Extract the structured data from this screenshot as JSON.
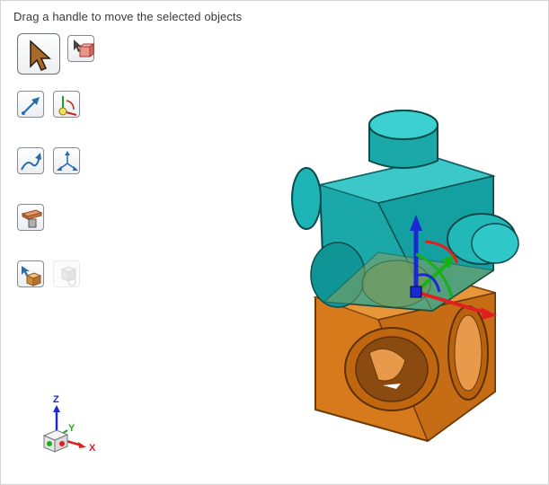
{
  "status": {
    "text": "Drag a handle to move the selected objects"
  },
  "toolbar": {
    "items": [
      {
        "name": "select-pointer-button",
        "icon": "arrow-pointer-icon",
        "active": true
      },
      {
        "name": "select-box-button",
        "icon": "pointer-box-icon"
      },
      {
        "name": "move-along-vector-button",
        "icon": "arrow-vector-icon"
      },
      {
        "name": "rotate-about-axis-button",
        "icon": "axis-rotate-icon"
      },
      {
        "name": "move-along-curve-button",
        "icon": "curve-arrow-icon"
      },
      {
        "name": "free-move-button",
        "icon": "triad-arrows-icon"
      },
      {
        "name": "align-faces-button",
        "icon": "align-block-icon"
      },
      {
        "name": "apply-move-button",
        "icon": "box-drag-icon"
      },
      {
        "name": "copy-move-button",
        "icon": "box-copy-icon",
        "disabled": true
      }
    ]
  },
  "view_triad": {
    "x_label": "X",
    "y_label": "Y",
    "z_label": "Z"
  },
  "colors": {
    "teal": "#1fb0b0",
    "orange": "#d97a1e",
    "x_axis": "#e02020",
    "y_axis": "#18b018",
    "z_axis": "#2020d0"
  }
}
